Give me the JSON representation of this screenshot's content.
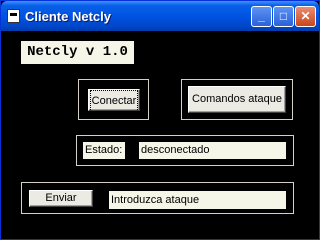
{
  "window": {
    "title": "Cliente Netcly",
    "icon": "app-icon",
    "controls": {
      "minimize": "_",
      "maximize": "□",
      "close": "✕"
    }
  },
  "header": {
    "title": "Netcly v 1.0"
  },
  "actions": {
    "connect_label": "Conectar",
    "commands_label": "Comandos ataque"
  },
  "status": {
    "label": "Estado:",
    "value": "desconectado"
  },
  "send": {
    "button_label": "Enviar",
    "input_value": "Introduzca ataque"
  }
}
